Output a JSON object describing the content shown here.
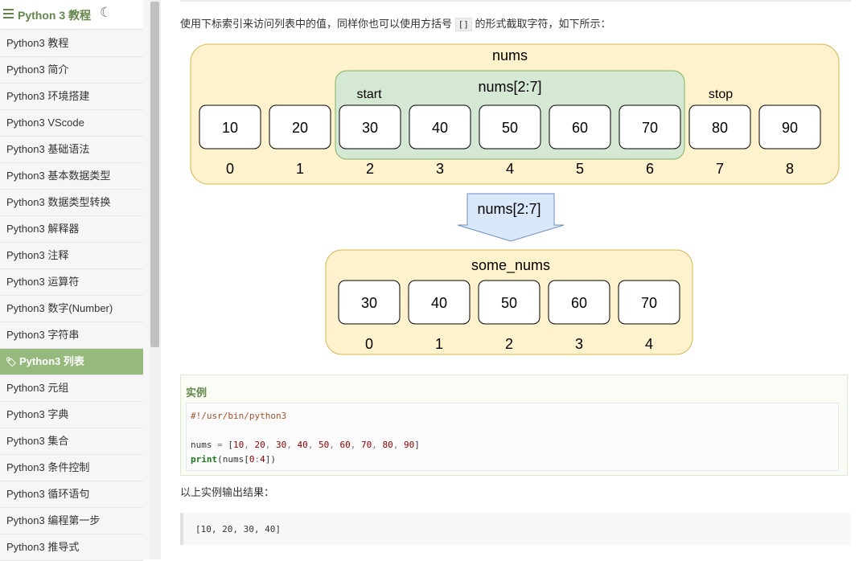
{
  "sidebar": {
    "title": "Python 3 教程",
    "items": [
      {
        "label": "Python3 教程",
        "active": false
      },
      {
        "label": "Python3 简介",
        "active": false
      },
      {
        "label": "Python3 环境搭建",
        "active": false
      },
      {
        "label": "Python3 VScode",
        "active": false
      },
      {
        "label": "Python3 基础语法",
        "active": false
      },
      {
        "label": "Python3 基本数据类型",
        "active": false
      },
      {
        "label": "Python3 数据类型转换",
        "active": false
      },
      {
        "label": "Python3 解释器",
        "active": false
      },
      {
        "label": "Python3 注释",
        "active": false
      },
      {
        "label": "Python3 运算符",
        "active": false
      },
      {
        "label": "Python3 数字(Number)",
        "active": false
      },
      {
        "label": "Python3 字符串",
        "active": false
      },
      {
        "label": "Python3 列表",
        "active": true
      },
      {
        "label": "Python3 元组",
        "active": false
      },
      {
        "label": "Python3 字典",
        "active": false
      },
      {
        "label": "Python3 集合",
        "active": false
      },
      {
        "label": "Python3 条件控制",
        "active": false
      },
      {
        "label": "Python3 循环语句",
        "active": false
      },
      {
        "label": "Python3 编程第一步",
        "active": false
      },
      {
        "label": "Python3 推导式",
        "active": false
      }
    ]
  },
  "content": {
    "intro_before": "使用下标索引来访问列表中的值，同样你也可以使用方括号",
    "intro_code": "[]",
    "intro_after": "的形式截取字符，如下所示：",
    "diagram": {
      "list_name": "nums",
      "values": [
        "10",
        "20",
        "30",
        "40",
        "50",
        "60",
        "70",
        "80",
        "90"
      ],
      "indices": [
        "0",
        "1",
        "2",
        "3",
        "4",
        "5",
        "6",
        "7",
        "8"
      ],
      "slice_label": "nums[2:7]",
      "start_label": "start",
      "stop_label": "stop",
      "arrow_label": "nums[2:7]",
      "result_name": "some_nums",
      "result_values": [
        "30",
        "40",
        "50",
        "60",
        "70"
      ],
      "result_indices": [
        "0",
        "1",
        "2",
        "3",
        "4"
      ]
    },
    "example_title": "实例",
    "code": {
      "line1": "#!/usr/bin/python3",
      "line3_var": "nums",
      "line3_eq": " = ",
      "line3_open": "[",
      "line3_nums": [
        "10",
        "20",
        "30",
        "40",
        "50",
        "60",
        "70",
        "80",
        "90"
      ],
      "line3_close": "]",
      "line4_kw": "print",
      "line4_rest_a": "(nums[",
      "line4_n1": "0",
      "line4_colon": ":",
      "line4_n2": "4",
      "line4_rest_b": "])"
    },
    "output_label": "以上实例输出结果：",
    "output": "[10, 20, 30, 40]"
  },
  "colors": {
    "brand_green": "#64854c",
    "active_bg": "#96b97d",
    "outer_fill": "#fff2cc",
    "outer_stroke": "#d6b656",
    "slice_fill": "#d5e8d4",
    "slice_stroke": "#82b366",
    "arrow_fill": "#dae8fc",
    "arrow_stroke": "#6c8ebf"
  }
}
